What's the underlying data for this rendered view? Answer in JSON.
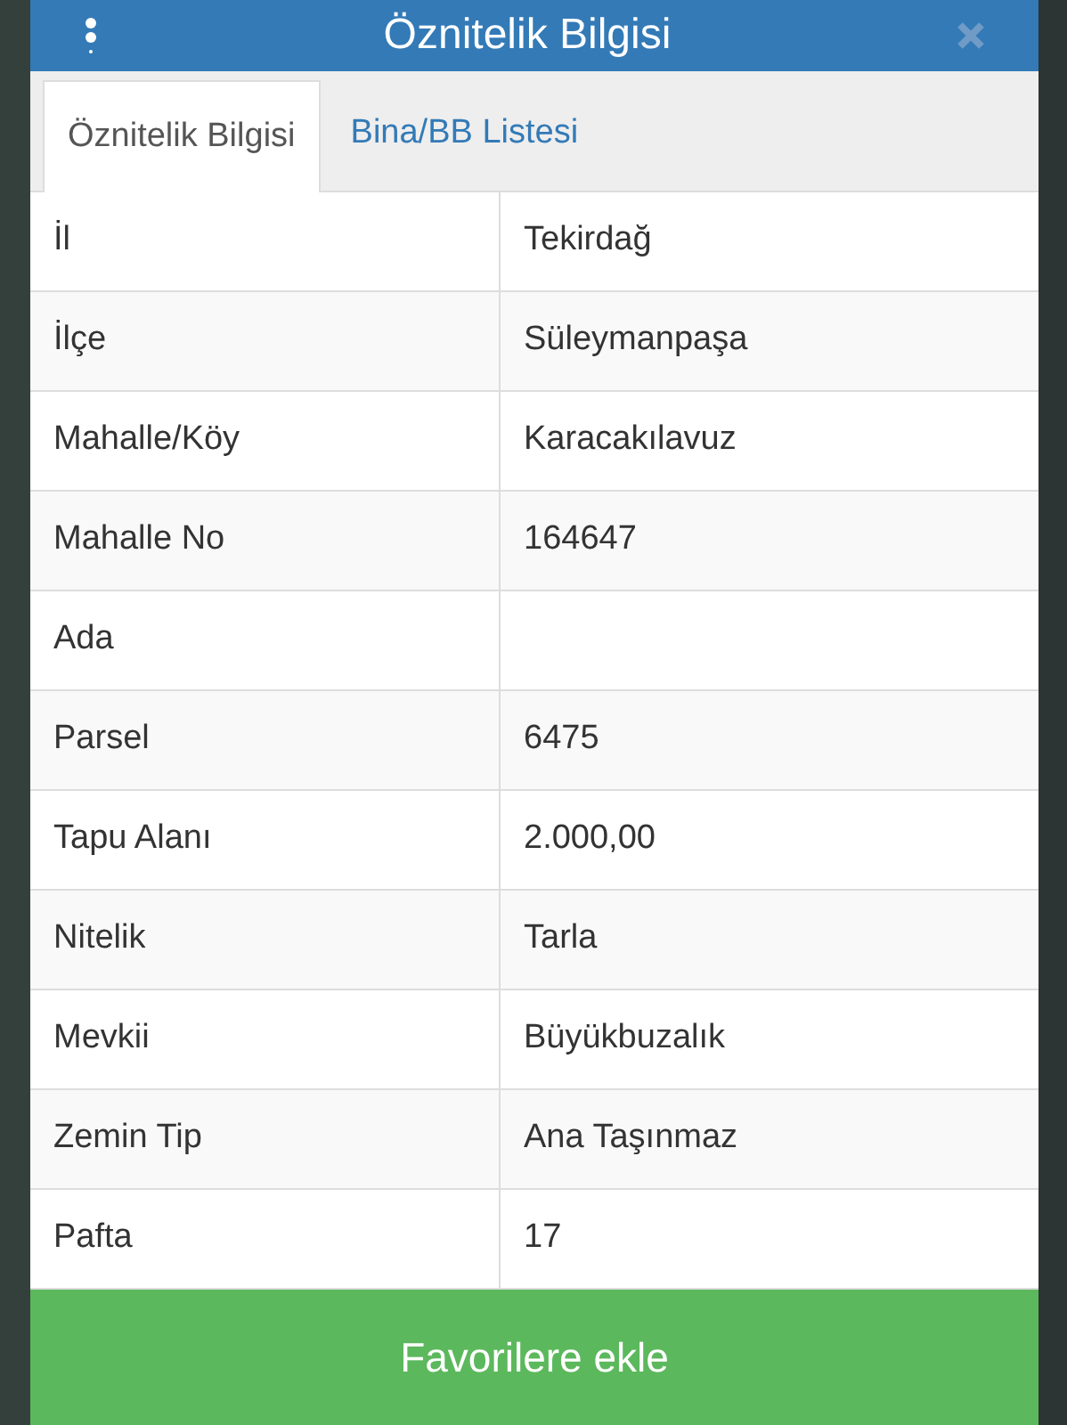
{
  "dialog": {
    "title": "Öznitelik Bilgisi"
  },
  "tabs": [
    {
      "label": "Öznitelik Bilgisi",
      "selected": true
    },
    {
      "label": "Bina/BB Listesi",
      "selected": false
    }
  ],
  "table": {
    "rows": [
      {
        "label": "İl",
        "value": "Tekirdağ"
      },
      {
        "label": "İlçe",
        "value": "Süleymanpaşa"
      },
      {
        "label": "Mahalle/Köy",
        "value": "Karacakılavuz"
      },
      {
        "label": "Mahalle No",
        "value": "164647"
      },
      {
        "label": "Ada",
        "value": ""
      },
      {
        "label": "Parsel",
        "value": "6475"
      },
      {
        "label": "Tapu Alanı",
        "value": "2.000,00"
      },
      {
        "label": "Nitelik",
        "value": "Tarla"
      },
      {
        "label": "Mevkii",
        "value": "Büyükbuzalık"
      },
      {
        "label": "Zemin Tip",
        "value": "Ana Taşınmaz"
      },
      {
        "label": "Pafta",
        "value": "17"
      }
    ]
  },
  "footer_button": {
    "label": "Favorilere ekle"
  }
}
